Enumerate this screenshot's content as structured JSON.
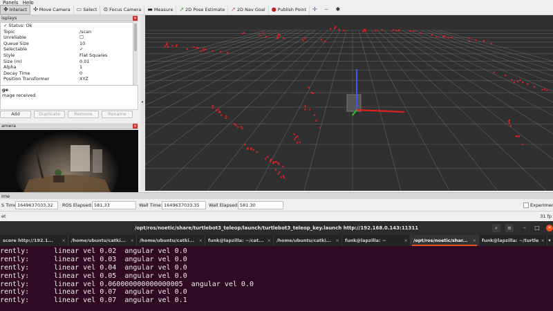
{
  "menu": {
    "items": [
      "Panels",
      "Help"
    ]
  },
  "toolbar": {
    "tools": [
      {
        "label": "Interact",
        "icon": "interact-icon"
      },
      {
        "label": "Move Camera",
        "icon": "move-camera-icon"
      },
      {
        "label": "Select",
        "icon": "select-icon"
      },
      {
        "label": "Focus Camera",
        "icon": "focus-camera-icon"
      },
      {
        "label": "Measure",
        "icon": "measure-icon"
      },
      {
        "label": "2D Pose Estimate",
        "icon": "pose-estimate-icon"
      },
      {
        "label": "2D Nav Goal",
        "icon": "nav-goal-icon"
      },
      {
        "label": "Publish Point",
        "icon": "publish-point-icon"
      }
    ]
  },
  "displays": {
    "title": "isplays",
    "rows": [
      {
        "key": "✓  Status: Ok",
        "value": ""
      },
      {
        "key": "Topic",
        "value": "/scan"
      },
      {
        "key": "Unreliable",
        "value": "☐"
      },
      {
        "key": "Queue Size",
        "value": "10"
      },
      {
        "key": "Selectable",
        "value": "✓"
      },
      {
        "key": "Style",
        "value": "Flat Squares"
      },
      {
        "key": "Size (m)",
        "value": "0.01"
      },
      {
        "key": "Alpha",
        "value": "1"
      },
      {
        "key": "Decay Time",
        "value": "0"
      },
      {
        "key": "Position Transformer",
        "value": "XYZ"
      }
    ],
    "desc_title": "ge",
    "desc_text": "mage received",
    "buttons": {
      "add": "Add",
      "duplicate": "Duplicate",
      "remove": "Remove",
      "rename": "Rename"
    }
  },
  "camera": {
    "title": "amera"
  },
  "time": {
    "title": "ime",
    "ros_time_label": "S Time:",
    "ros_time": "1649637033.32",
    "ros_elapsed_label": "ROS Elapsed:",
    "ros_elapsed": "581.33",
    "wall_time_label": "Wall Time:",
    "wall_time": "1649637033.35",
    "wall_elapsed_label": "Wall Elapsed:",
    "wall_elapsed": "581.30",
    "experimental_label": "Experiment",
    "reset_label": "et",
    "fps": "31 fp"
  },
  "terminal": {
    "title": "/opt/ros/noetic/share/turtlebot3_teleop/launch/turtlebot3_teleop_key.launch http://192.168.0.143:11311",
    "tabs": [
      "score http://192.1...",
      "/home/ubuntu/catki...",
      "/home/ubuntu/catki...",
      "funk@lapzilla: ~/cat...",
      "/home/ubuntu/catki...",
      "funk@lapzilla: ~",
      "/opt/ros/noetic/shar...",
      "funk@lapzilla: ~/turtle"
    ],
    "active_tab": 6,
    "lines": [
      {
        "a": "rently:",
        "b": "linear vel 0.02  angular vel 0.0"
      },
      {
        "a": "rently:",
        "b": "linear vel 0.03  angular vel 0.0"
      },
      {
        "a": "rently:",
        "b": "linear vel 0.04  angular vel 0.0"
      },
      {
        "a": "rently:",
        "b": "linear vel 0.05  angular vel 0.0"
      },
      {
        "a": "rently:",
        "b": "linear vel 0.060000000000000005  angular vel 0.0"
      },
      {
        "a": "rently:",
        "b": "linear vel 0.07  angular vel 0.0"
      },
      {
        "a": "rently:",
        "b": "linear vel 0.07  angular vel 0.1"
      }
    ]
  },
  "colors": {
    "scan_points": "#e02020",
    "grid_lines": "#8a8a8a",
    "view_background": "#303030",
    "terminal_background": "#300a24",
    "accent": "#e95420"
  }
}
